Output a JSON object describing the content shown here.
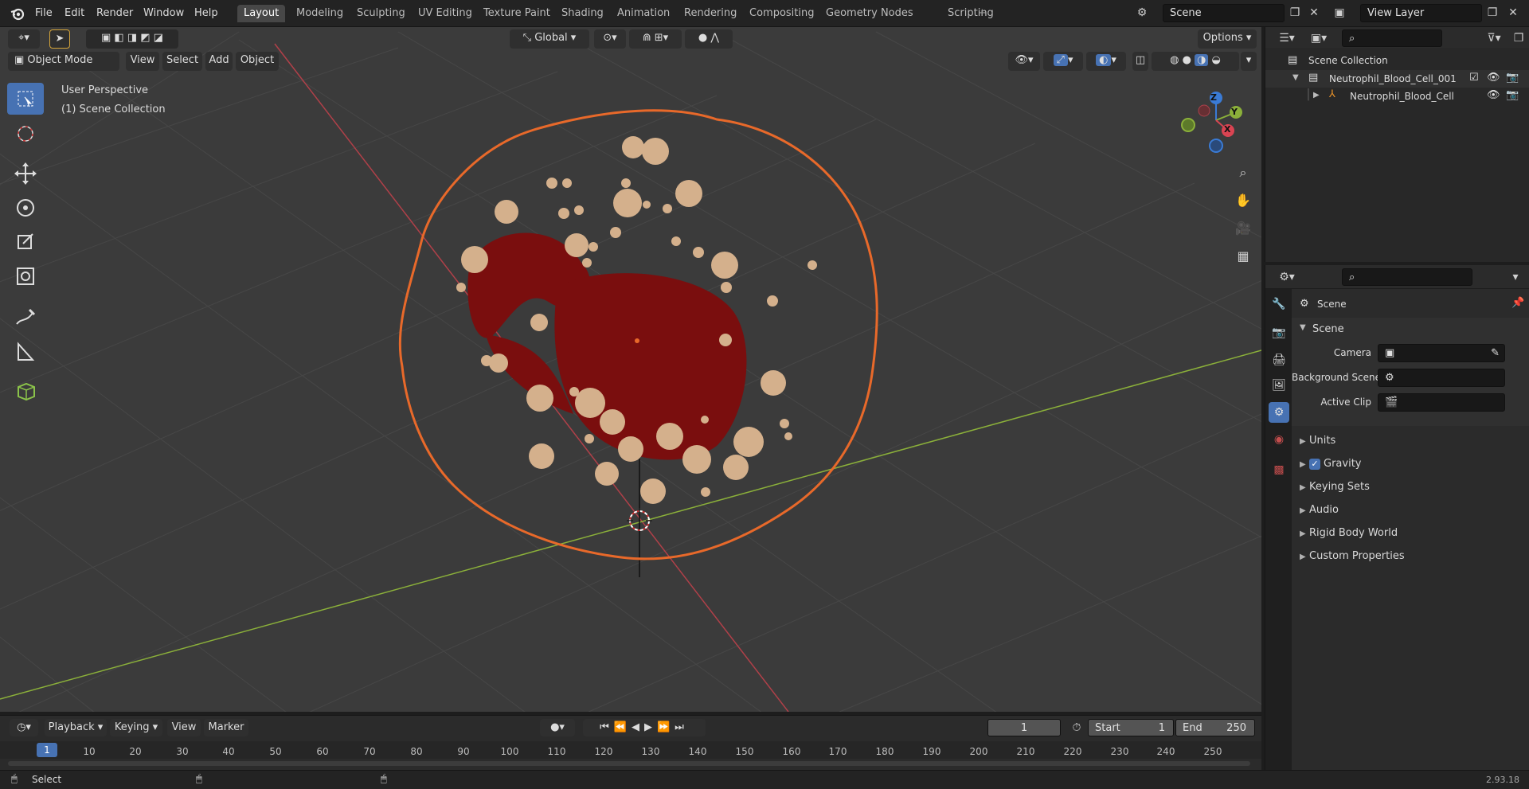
{
  "app": {
    "menus": [
      "File",
      "Edit",
      "Render",
      "Window",
      "Help"
    ],
    "workspaces": [
      "Layout",
      "Modeling",
      "Sculpting",
      "UV Editing",
      "Texture Paint",
      "Shading",
      "Animation",
      "Rendering",
      "Compositing",
      "Geometry Nodes",
      "Scripting"
    ],
    "active_workspace": "Layout",
    "scene_name": "Scene",
    "view_layer": "View Layer"
  },
  "viewport": {
    "mode": "Object Mode",
    "menus": [
      "View",
      "Select",
      "Add",
      "Object"
    ],
    "transform_orientation": "Global",
    "options_label": "Options",
    "perspective_label": "User Perspective",
    "collection_label": "(1) Scene Collection",
    "gizmo_axes": [
      "X",
      "Y",
      "Z"
    ]
  },
  "outliner": {
    "root": "Scene Collection",
    "items": [
      {
        "label": "Neutrophil_Blood_Cell_001"
      },
      {
        "label": "Neutrophil_Blood_Cell"
      }
    ]
  },
  "properties": {
    "context_title": "Scene",
    "panel_title": "Scene",
    "fields": [
      {
        "label": "Camera"
      },
      {
        "label": "Background Scene"
      },
      {
        "label": "Active Clip"
      }
    ],
    "sections": [
      "Units",
      "Gravity",
      "Keying Sets",
      "Audio",
      "Rigid Body World",
      "Custom Properties"
    ],
    "gravity_checked": true
  },
  "timeline": {
    "menus": [
      "Playback",
      "Keying",
      "View",
      "Marker"
    ],
    "current_frame": "1",
    "start_label": "Start",
    "start_value": "1",
    "end_label": "End",
    "end_value": "250",
    "ruler": [
      "10",
      "20",
      "30",
      "40",
      "50",
      "60",
      "70",
      "80",
      "90",
      "100",
      "110",
      "120",
      "130",
      "140",
      "150",
      "160",
      "170",
      "180",
      "190",
      "200",
      "210",
      "220",
      "230",
      "240",
      "250"
    ],
    "ruler_current": "1"
  },
  "status": {
    "left": "Select",
    "version": "2.93.18"
  },
  "colors": {
    "accent": "#4772b3",
    "selection_outline": "#e8692a",
    "cell_body": "#7a0e0e",
    "granules": "#d4b08c",
    "x_axis": "#c0444c",
    "y_axis": "#8bb03a"
  }
}
